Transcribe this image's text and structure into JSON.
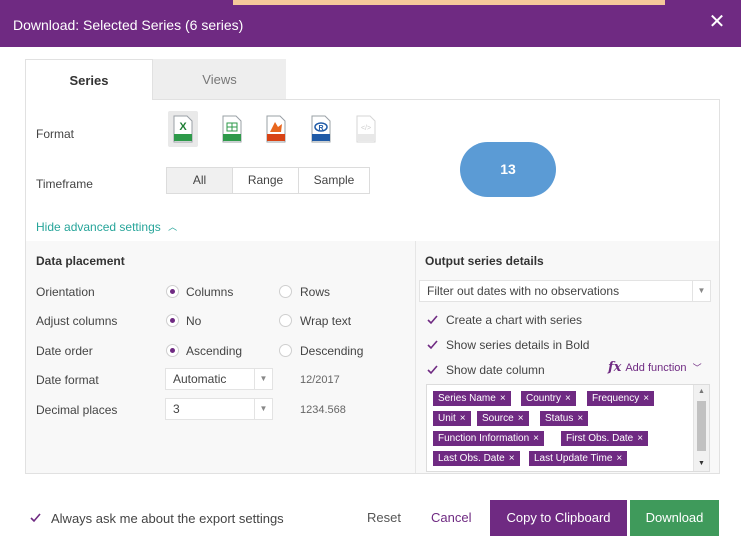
{
  "dialog": {
    "title": "Download: Selected Series (6 series)",
    "close_glyph": "✕",
    "colors": {
      "header": "#6f2a82",
      "accent": "#27a59a",
      "download": "#3f9a5b",
      "badge": "#5b9bd5"
    }
  },
  "tabs": [
    {
      "label": "Series",
      "active": true
    },
    {
      "label": "Views",
      "active": false
    }
  ],
  "format": {
    "label": "Format",
    "options": [
      {
        "name": "xls-icon",
        "caption": "XLS",
        "selected": true
      },
      {
        "name": "csv-icon",
        "caption": "CSV",
        "selected": false
      },
      {
        "name": "matlab-icon",
        "caption": "MATLAB",
        "selected": false
      },
      {
        "name": "r-icon",
        "caption": "R",
        "selected": false
      },
      {
        "name": "json-icon",
        "caption": "JSON",
        "selected": false
      }
    ]
  },
  "timeframe": {
    "label": "Timeframe",
    "options": [
      "All",
      "Range",
      "Sample"
    ],
    "selected": "All"
  },
  "annotation_badge": "13",
  "advanced": {
    "toggle_label": "Hide advanced settings",
    "chevron": "^"
  },
  "data_placement": {
    "title": "Data placement",
    "orientation": {
      "label": "Orientation",
      "opt1": "Columns",
      "opt2": "Rows",
      "selected": "Columns"
    },
    "adjust_columns": {
      "label": "Adjust columns",
      "opt1": "No",
      "opt2": "Wrap text",
      "selected": "No"
    },
    "date_order": {
      "label": "Date order",
      "opt1": "Ascending",
      "opt2": "Descending",
      "selected": "Ascending"
    },
    "date_format": {
      "label": "Date format",
      "value": "Automatic",
      "example": "12/2017"
    },
    "decimal_places": {
      "label": "Decimal places",
      "value": "3",
      "example": "1234.568"
    }
  },
  "output_details": {
    "title": "Output series details",
    "filter_select": "Filter out dates with no observations",
    "create_chart": {
      "label": "Create a chart with series",
      "checked": true
    },
    "bold_details": {
      "label": "Show series details in Bold",
      "checked": true
    },
    "date_column": {
      "label": "Show date column",
      "checked": true
    },
    "add_function": {
      "fx": "fx",
      "label": "Add function"
    },
    "tags": [
      "Series Name",
      "Country",
      "Frequency",
      "Unit",
      "Source",
      "Status",
      "Function Information",
      "First Obs. Date",
      "Last Obs. Date",
      "Last Update Time"
    ],
    "tag_remove": "×"
  },
  "footer": {
    "always_ask": {
      "label": "Always ask me about the export settings",
      "checked": true
    },
    "reset": "Reset",
    "cancel": "Cancel",
    "copy": "Copy to Clipboard",
    "download": "Download"
  }
}
